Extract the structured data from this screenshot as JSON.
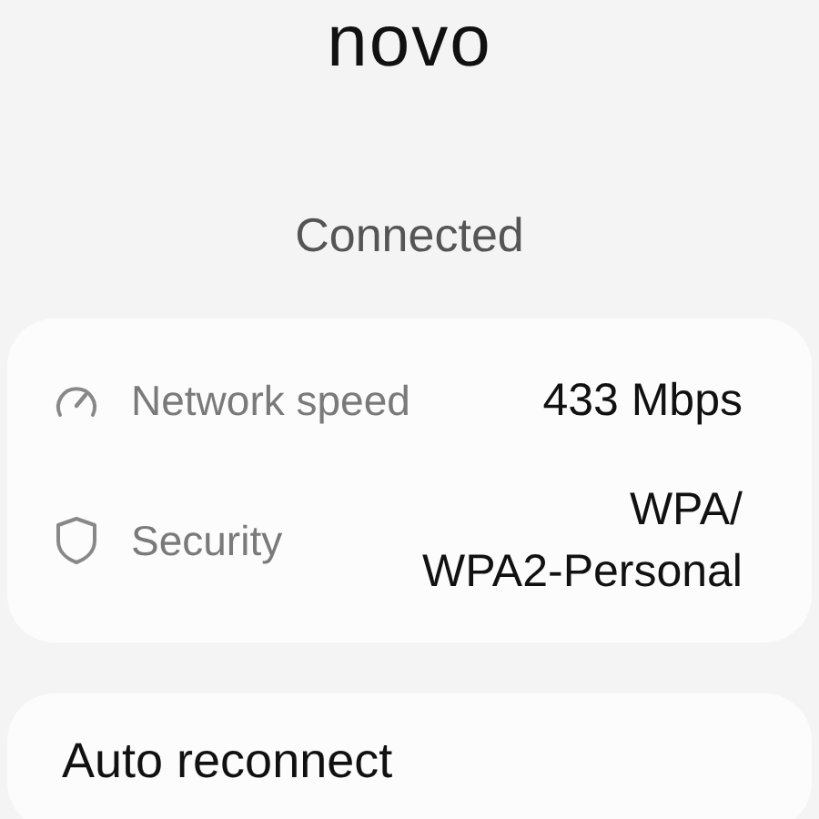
{
  "network": {
    "name": "novo",
    "status": "Connected"
  },
  "details": [
    {
      "kind": "speed",
      "label": "Network speed",
      "value": "433 Mbps"
    },
    {
      "kind": "security",
      "label": "Security",
      "value": "WPA/\nWPA2-Personal"
    }
  ],
  "settings": [
    {
      "label": "Auto reconnect"
    }
  ]
}
